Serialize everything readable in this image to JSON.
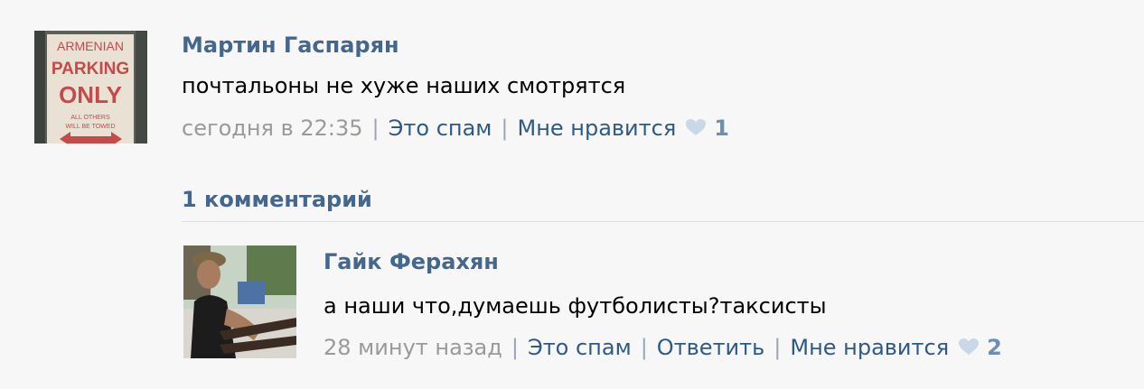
{
  "post": {
    "author": "Мартин Гаспарян",
    "text": "почтальоны не хуже наших смотрятся",
    "time": "сегодня в 22:35",
    "spam_label": "Это спам",
    "like_label": "Мне нравится",
    "like_count": "1",
    "avatar_sign_text": [
      "ARMENIAN",
      "PARKING",
      "ONLY",
      "ALL OTHERS",
      "WILL BE TOWED"
    ]
  },
  "comments": {
    "count_label": "1 комментарий"
  },
  "reply": {
    "author": "Гайк Ферахян",
    "text": "а наши что,думаешь футболисты?таксисты",
    "time": "28 минут назад",
    "spam_label": "Это спам",
    "reply_label": "Ответить",
    "like_label": "Мне нравится",
    "like_count": "2"
  },
  "colors": {
    "author": "#45678d",
    "link": "#2f5a85",
    "meta": "#9a9a9a",
    "heart": "#c9d7e6",
    "like_count": "#6d8fb3"
  }
}
